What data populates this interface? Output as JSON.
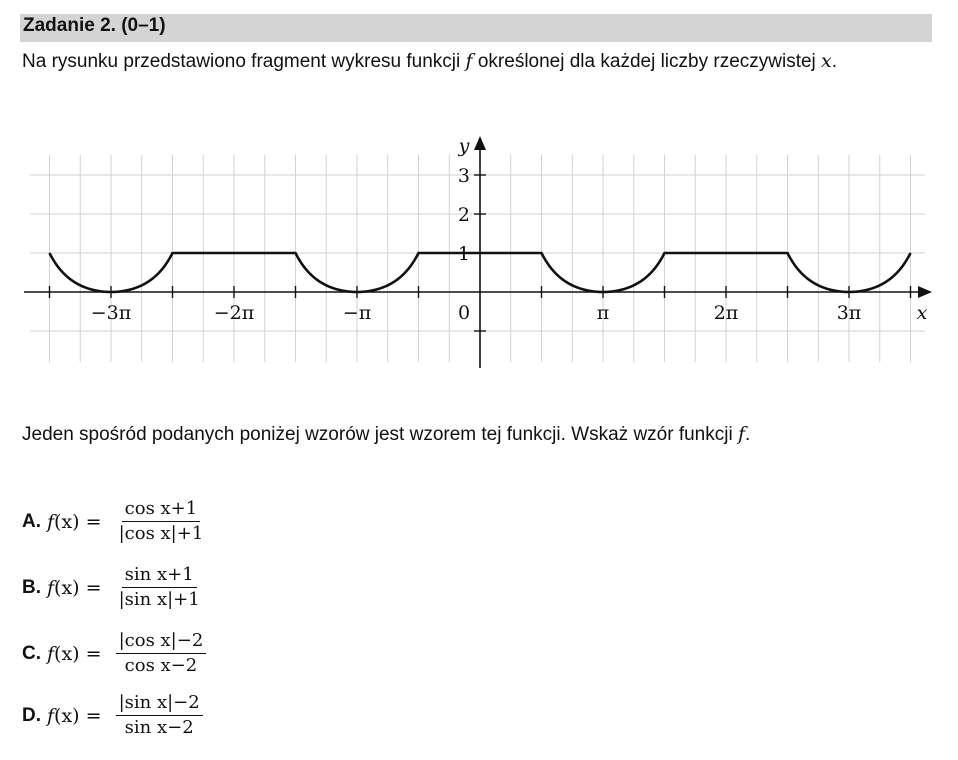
{
  "task": {
    "title": "Zadanie 2. (0–1)",
    "statement_part1": "Na rysunku przedstawiono fragment wykresu funkcji ",
    "statement_var_f": "f",
    "statement_part2": " określonej dla każdej liczby rzeczywistej ",
    "statement_var_x": "x",
    "statement_end": "."
  },
  "chart_data": {
    "type": "line",
    "xlabel": "x",
    "ylabel": "y",
    "x_tick_labels": [
      "−3π",
      "−2π",
      "−π",
      "0",
      "π",
      "2π",
      "3π"
    ],
    "y_tick_labels": [
      "1",
      "2",
      "3"
    ],
    "xlim": [
      -3.5,
      3.5
    ],
    "ylim": [
      -1,
      3
    ],
    "x_units": "multiples of π",
    "grid": true,
    "series": [
      {
        "x": [
          -3.5,
          -3,
          -2.5,
          -2,
          -1.5,
          -1,
          -0.5,
          0,
          0.5,
          1,
          1.5,
          2,
          2.5,
          3,
          3.5
        ],
        "y": [
          1,
          0.333,
          1,
          1,
          1,
          0.333,
          1,
          1,
          1,
          0.333,
          1,
          1,
          1,
          0.333,
          1
        ]
      }
    ]
  },
  "instruction": {
    "text": "Jeden spośród podanych poniżej wzorów jest wzorem tej funkcji. Wskaż wzór funkcji ",
    "var": "f",
    "end": "."
  },
  "options": [
    {
      "letter": "A.",
      "lhs_f": "f",
      "lhs_rest": "(x) = ",
      "numerator": "cos x+1",
      "denominator": "|cos x|+1"
    },
    {
      "letter": "B.",
      "lhs_f": "f",
      "lhs_rest": "(x) = ",
      "numerator": "sin x+1",
      "denominator": "|sin x|+1"
    },
    {
      "letter": "C.",
      "lhs_f": "f",
      "lhs_rest": "(x) = ",
      "numerator": "|cos x|−2",
      "denominator": "cos x−2"
    },
    {
      "letter": "D.",
      "lhs_f": "f",
      "lhs_rest": "(x) = ",
      "numerator": "|sin x|−2",
      "denominator": "sin x−2"
    }
  ]
}
